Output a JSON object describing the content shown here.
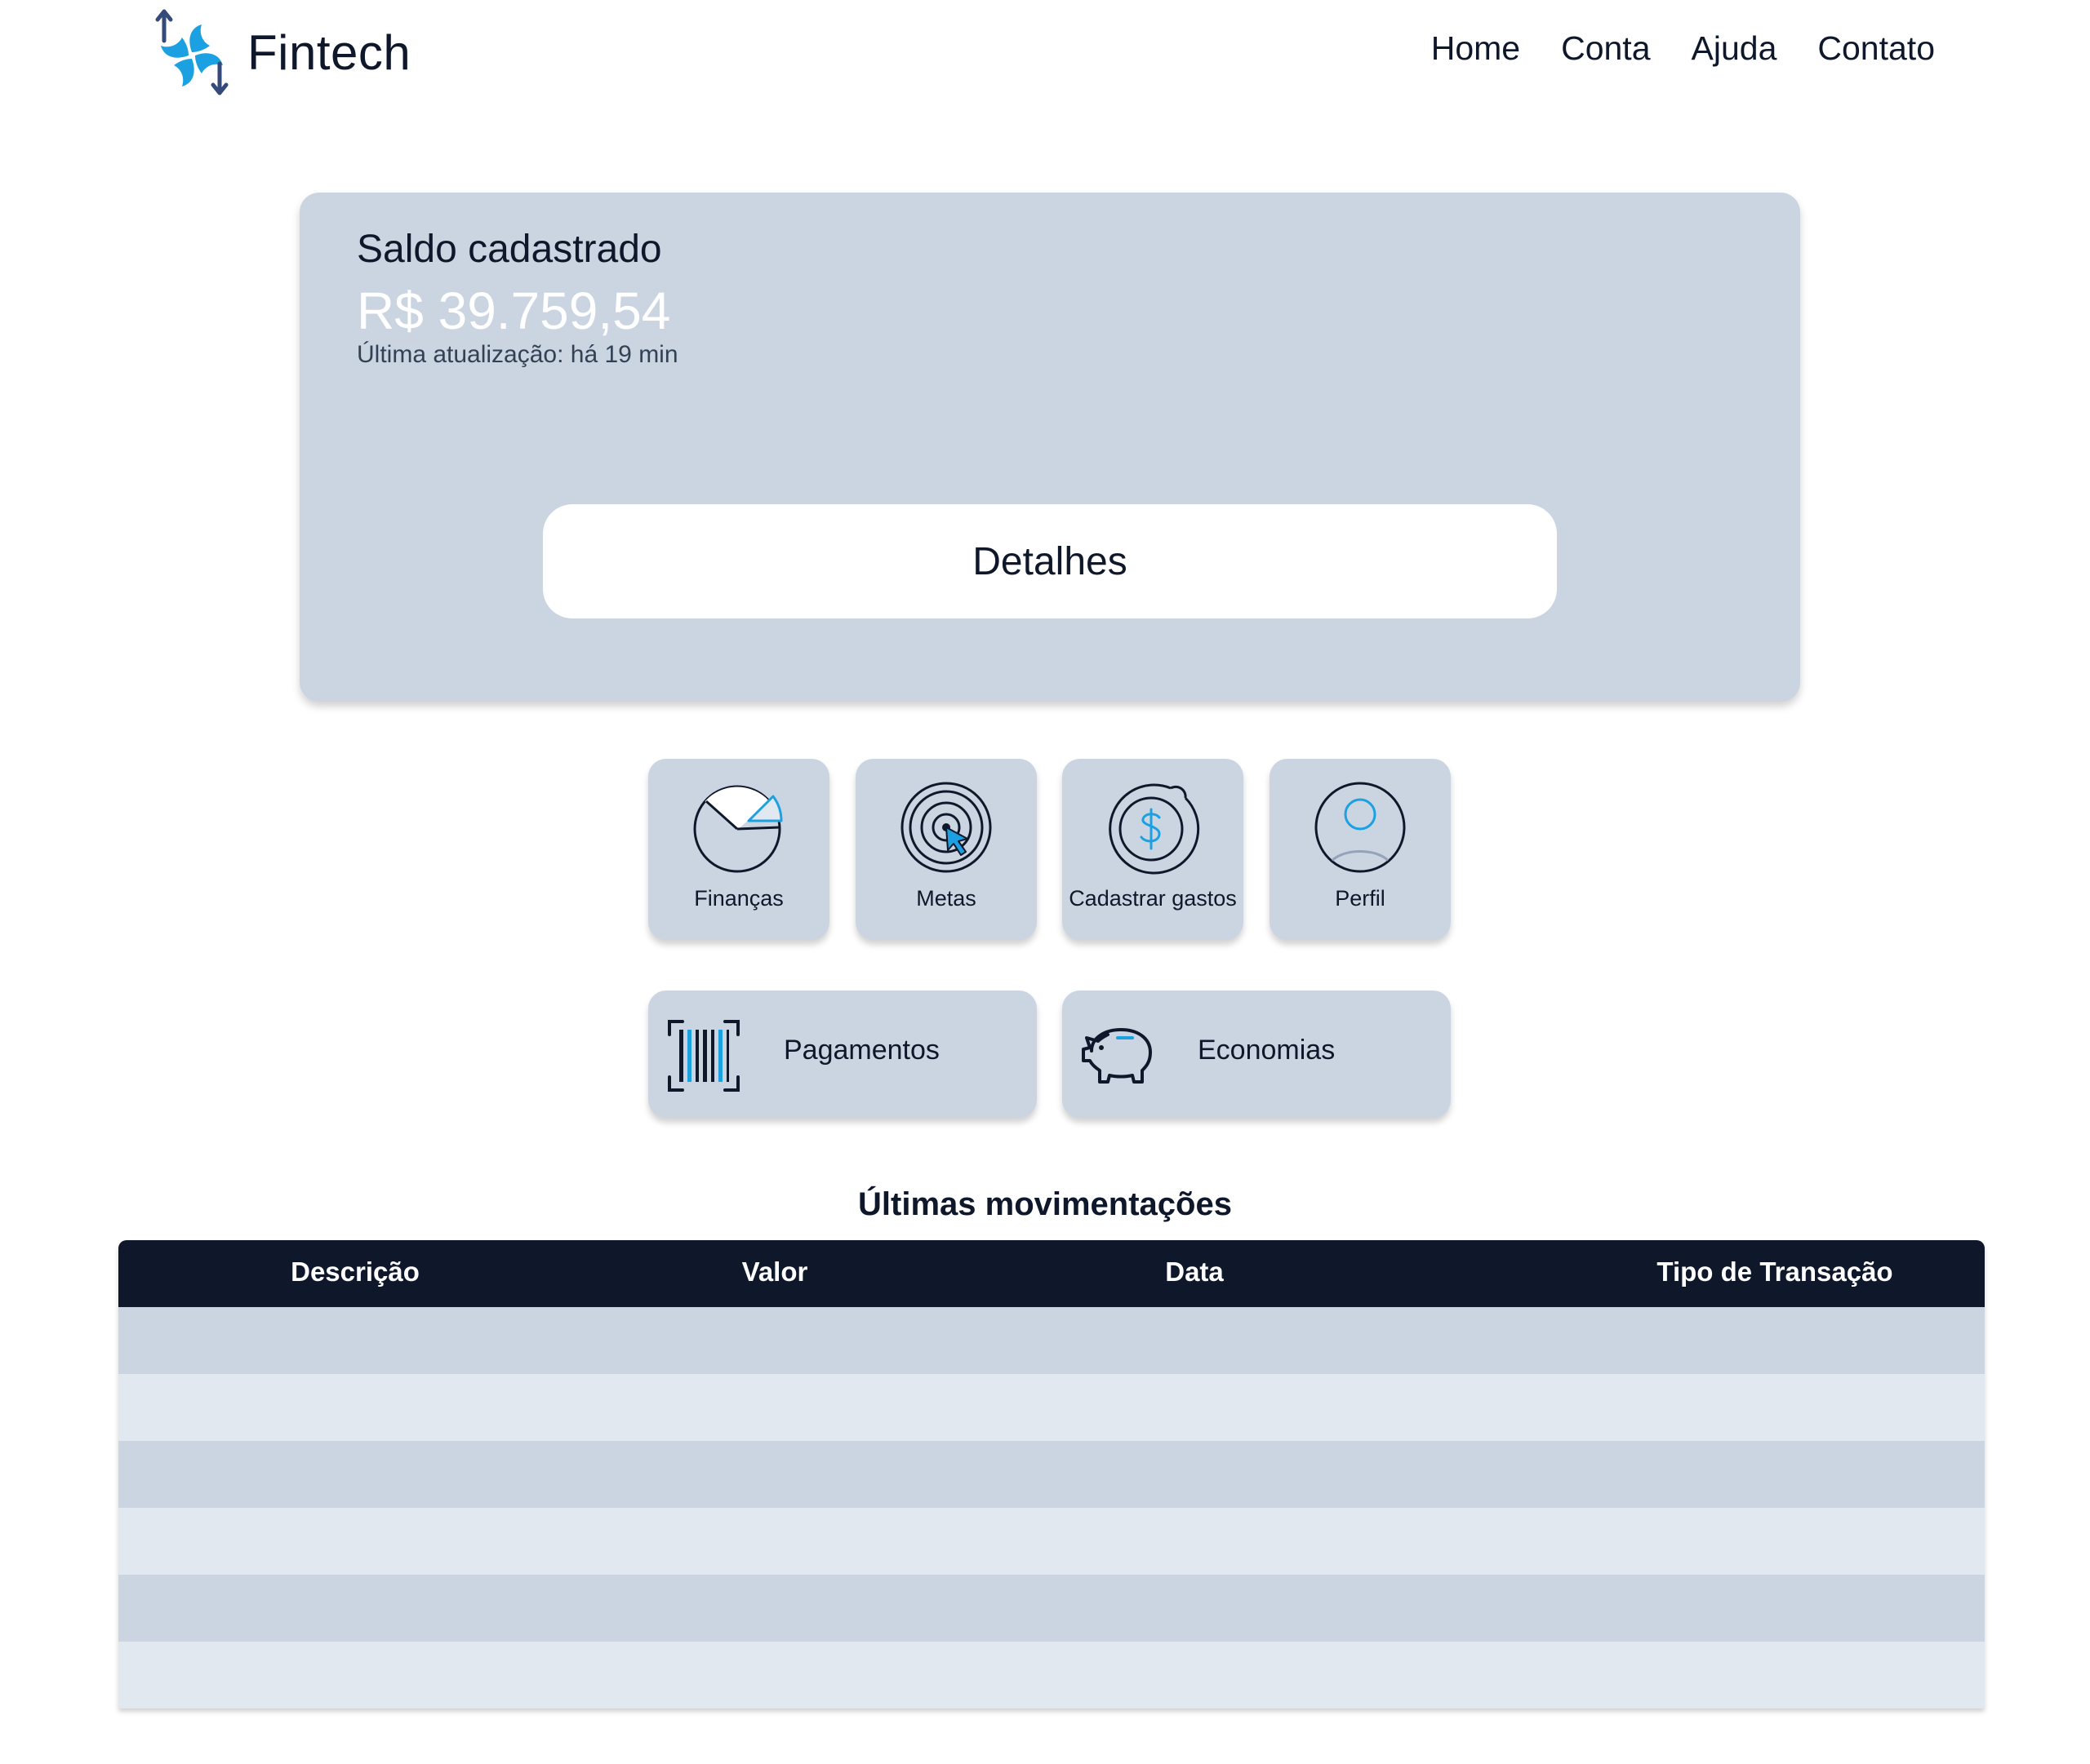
{
  "brand": {
    "name": "Fintech",
    "colors": {
      "primary_blue": "#1ba1e2",
      "navy": "#0f172a",
      "arrow_navy": "#334a7a",
      "card_bg": "#cbd5e1",
      "row_light": "#e2e8f0"
    }
  },
  "nav": {
    "items": [
      {
        "label": "Home"
      },
      {
        "label": "Conta"
      },
      {
        "label": "Ajuda"
      },
      {
        "label": "Contato"
      }
    ]
  },
  "balance": {
    "title": "Saldo cadastrado",
    "value": "R$ 39.759,54",
    "updated": "Última atualização: há 19 min",
    "details_label": "Detalhes"
  },
  "actions": {
    "tiles": [
      {
        "label": "Finanças",
        "icon": "pie-chart-icon"
      },
      {
        "label": "Metas",
        "icon": "target-icon"
      },
      {
        "label": "Cadastrar gastos",
        "icon": "dollar-circle-icon"
      },
      {
        "label": "Perfil",
        "icon": "user-icon"
      }
    ],
    "wide": [
      {
        "label": "Pagamentos",
        "icon": "barcode-icon"
      },
      {
        "label": "Economias",
        "icon": "piggy-bank-icon"
      }
    ]
  },
  "movements": {
    "title": "Últimas movimentações",
    "columns": [
      "Descrição",
      "Valor",
      "Data",
      "Tipo de Transação"
    ],
    "rows": [
      [],
      [],
      [],
      [],
      [],
      []
    ]
  }
}
